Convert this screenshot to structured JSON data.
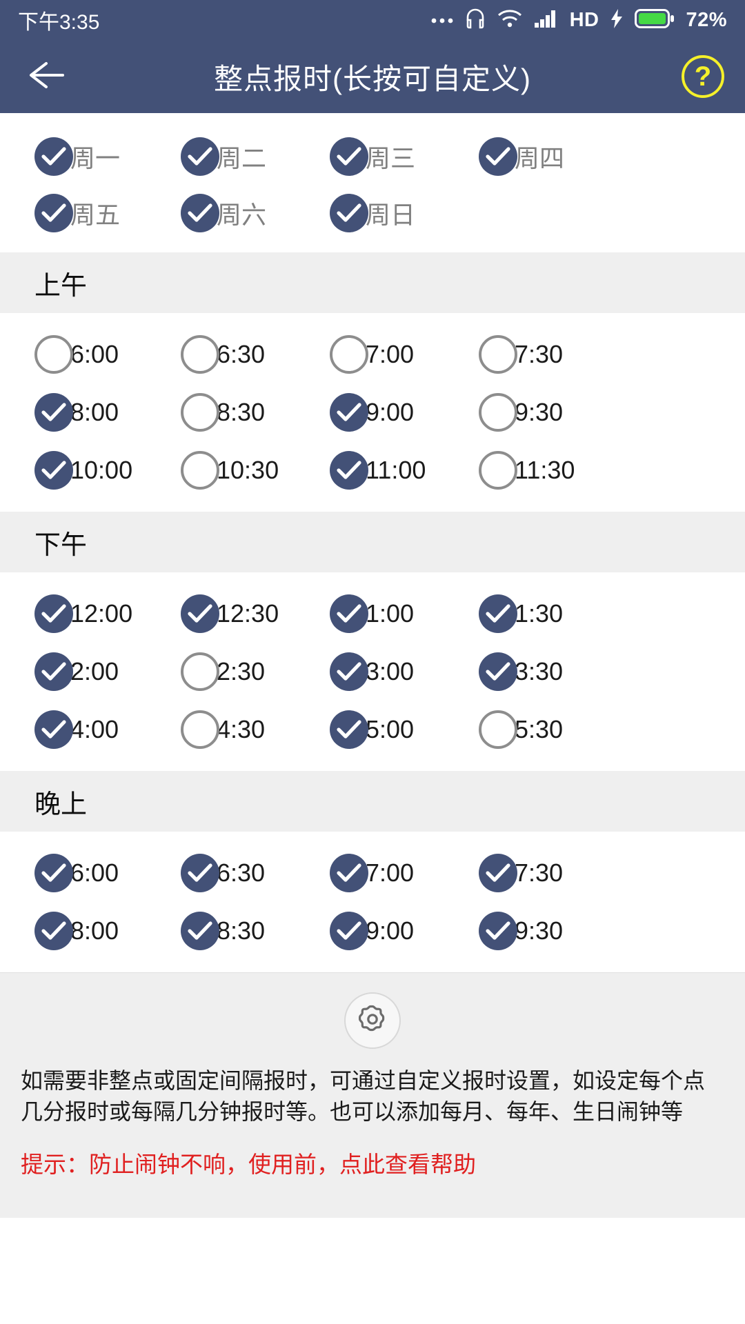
{
  "status_bar": {
    "time": "下午3:35",
    "battery_percent": "72%",
    "network_label": "HD",
    "icons": [
      "ellipsis-icon",
      "headphone-icon",
      "wifi-icon",
      "signal-icon",
      "hd-icon",
      "charging-bolt-icon",
      "battery-icon"
    ],
    "background": "#435177"
  },
  "title_bar": {
    "back_icon": "back-arrow-icon",
    "title": "整点报时(长按可自定义)",
    "help_label": "?",
    "help_color": "#f5f02a",
    "background": "#435177"
  },
  "weekdays": {
    "items": [
      {
        "label": "周一",
        "checked": true
      },
      {
        "label": "周二",
        "checked": true
      },
      {
        "label": "周三",
        "checked": true
      },
      {
        "label": "周四",
        "checked": true
      },
      {
        "label": "周五",
        "checked": true
      },
      {
        "label": "周六",
        "checked": true
      },
      {
        "label": "周日",
        "checked": true
      }
    ]
  },
  "sections": [
    {
      "title": "上午",
      "items": [
        {
          "label": "6:00",
          "checked": false
        },
        {
          "label": "6:30",
          "checked": false
        },
        {
          "label": "7:00",
          "checked": false
        },
        {
          "label": "7:30",
          "checked": false
        },
        {
          "label": "8:00",
          "checked": true
        },
        {
          "label": "8:30",
          "checked": false
        },
        {
          "label": "9:00",
          "checked": true
        },
        {
          "label": "9:30",
          "checked": false
        },
        {
          "label": "10:00",
          "checked": true
        },
        {
          "label": "10:30",
          "checked": false
        },
        {
          "label": "11:00",
          "checked": true
        },
        {
          "label": "11:30",
          "checked": false
        }
      ]
    },
    {
      "title": "下午",
      "items": [
        {
          "label": "12:00",
          "checked": true
        },
        {
          "label": "12:30",
          "checked": true
        },
        {
          "label": "1:00",
          "checked": true
        },
        {
          "label": "1:30",
          "checked": true
        },
        {
          "label": "2:00",
          "checked": true
        },
        {
          "label": "2:30",
          "checked": false
        },
        {
          "label": "3:00",
          "checked": true
        },
        {
          "label": "3:30",
          "checked": true
        },
        {
          "label": "4:00",
          "checked": true
        },
        {
          "label": "4:30",
          "checked": false
        },
        {
          "label": "5:00",
          "checked": true
        },
        {
          "label": "5:30",
          "checked": false
        }
      ]
    },
    {
      "title": "晚上",
      "items": [
        {
          "label": "6:00",
          "checked": true
        },
        {
          "label": "6:30",
          "checked": true
        },
        {
          "label": "7:00",
          "checked": true
        },
        {
          "label": "7:30",
          "checked": true
        },
        {
          "label": "8:00",
          "checked": true
        },
        {
          "label": "8:30",
          "checked": true
        },
        {
          "label": "9:00",
          "checked": true
        },
        {
          "label": "9:30",
          "checked": true
        }
      ]
    }
  ],
  "footer": {
    "gear_icon": "gear-icon",
    "description": "如需要非整点或固定间隔报时，可通过自定义报时设置，如设定每个点几分报时或每隔几分钟报时等。也可以添加每月、每年、生日闹钟等",
    "tip": "提示：防止闹钟不响，使用前，点此查看帮助",
    "tip_color": "#e02020"
  },
  "theme": {
    "accent": "#435177",
    "section_bg": "#efefef",
    "unchecked_border": "#8d8d8d"
  }
}
